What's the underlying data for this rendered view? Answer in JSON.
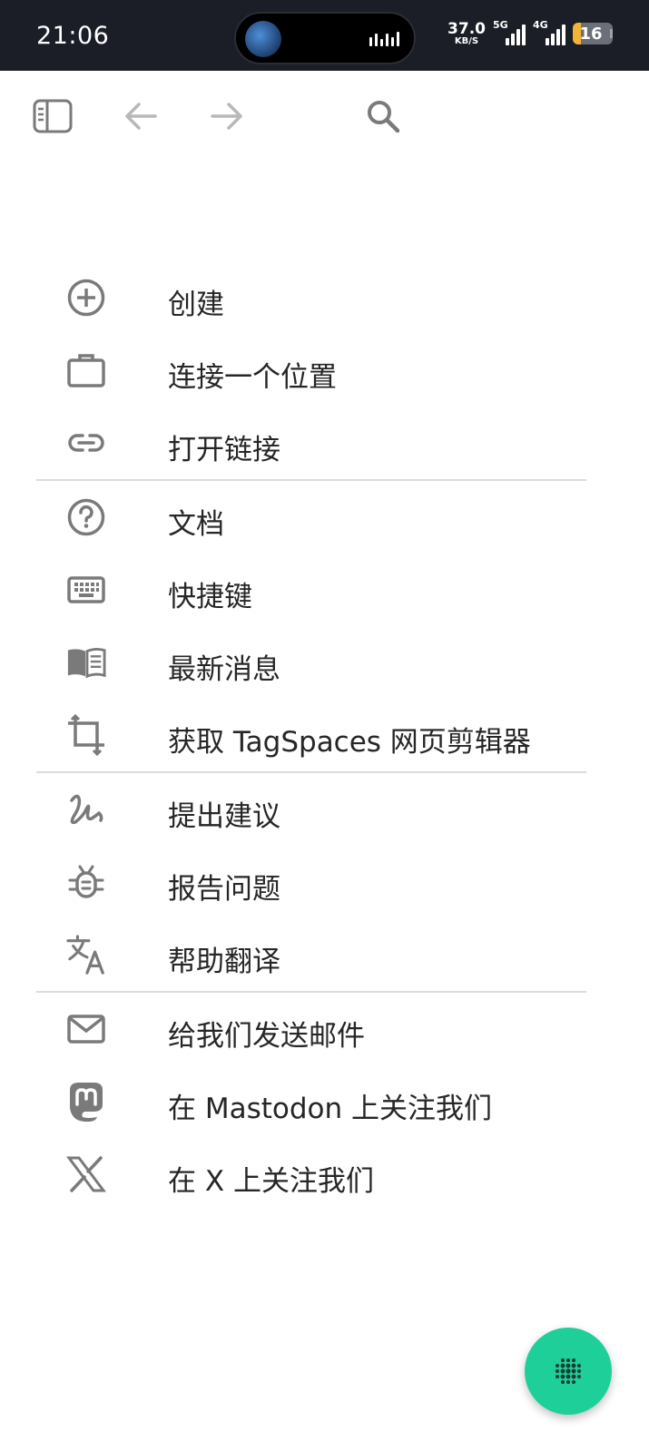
{
  "status_bar": {
    "time": "21:06",
    "net_speed_value": "37.0",
    "net_speed_unit": "KB/S",
    "signal1_label": "5G",
    "signal2_label": "4G",
    "battery_level": "16",
    "battery_color": "#f5b335"
  },
  "toolbar": {
    "sidebar_icon": "sidebar-toggle-icon",
    "back_icon": "arrow-left-icon",
    "forward_icon": "arrow-right-icon",
    "search_icon": "search-icon"
  },
  "menu": {
    "group1": [
      {
        "icon": "add-circle-icon",
        "label": "创建"
      },
      {
        "icon": "briefcase-icon",
        "label": "连接一个位置"
      },
      {
        "icon": "link-icon",
        "label": "打开链接"
      }
    ],
    "group2": [
      {
        "icon": "help-circle-icon",
        "label": "文档"
      },
      {
        "icon": "keyboard-icon",
        "label": "快捷键"
      },
      {
        "icon": "book-icon",
        "label": "最新消息"
      },
      {
        "icon": "crop-icon",
        "label": "获取 TagSpaces 网页剪辑器"
      }
    ],
    "group3": [
      {
        "icon": "gesture-icon",
        "label": "提出建议"
      },
      {
        "icon": "bug-icon",
        "label": "报告问题"
      },
      {
        "icon": "translate-icon",
        "label": "帮助翻译"
      }
    ],
    "group4": [
      {
        "icon": "mail-icon",
        "label": "给我们发送邮件"
      },
      {
        "icon": "mastodon-icon",
        "label": "在 Mastodon 上关注我们"
      },
      {
        "icon": "x-logo-icon",
        "label": "在 X 上关注我们"
      }
    ]
  },
  "fab": {
    "icon": "dots-grid-icon",
    "color": "#1fcf9a"
  },
  "colors": {
    "icon": "#7a7a7a",
    "text": "#262626",
    "divider": "#dcdcdc"
  }
}
